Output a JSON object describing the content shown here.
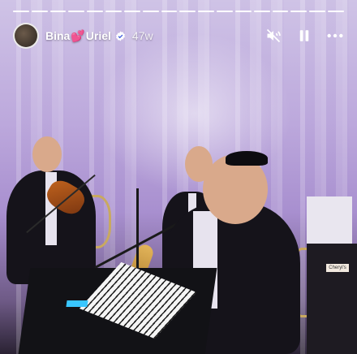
{
  "story": {
    "segments_total": 18,
    "segments_done": 18,
    "username_part1": "Bina",
    "heart_emoji": "💕",
    "username_part2": "Uriel",
    "verified": true,
    "posted_ago": "47w",
    "controls": [
      "mute-icon",
      "pause-icon",
      "more-icon"
    ]
  },
  "scene": {
    "description_icons": [
      "violin",
      "saxophone",
      "keyboard",
      "microphone"
    ],
    "card_text": "Cheryl's"
  },
  "colors": {
    "progress_fill": "#ffffff",
    "heart": "#ff5fa2",
    "verified_badge": "#ffffff"
  }
}
